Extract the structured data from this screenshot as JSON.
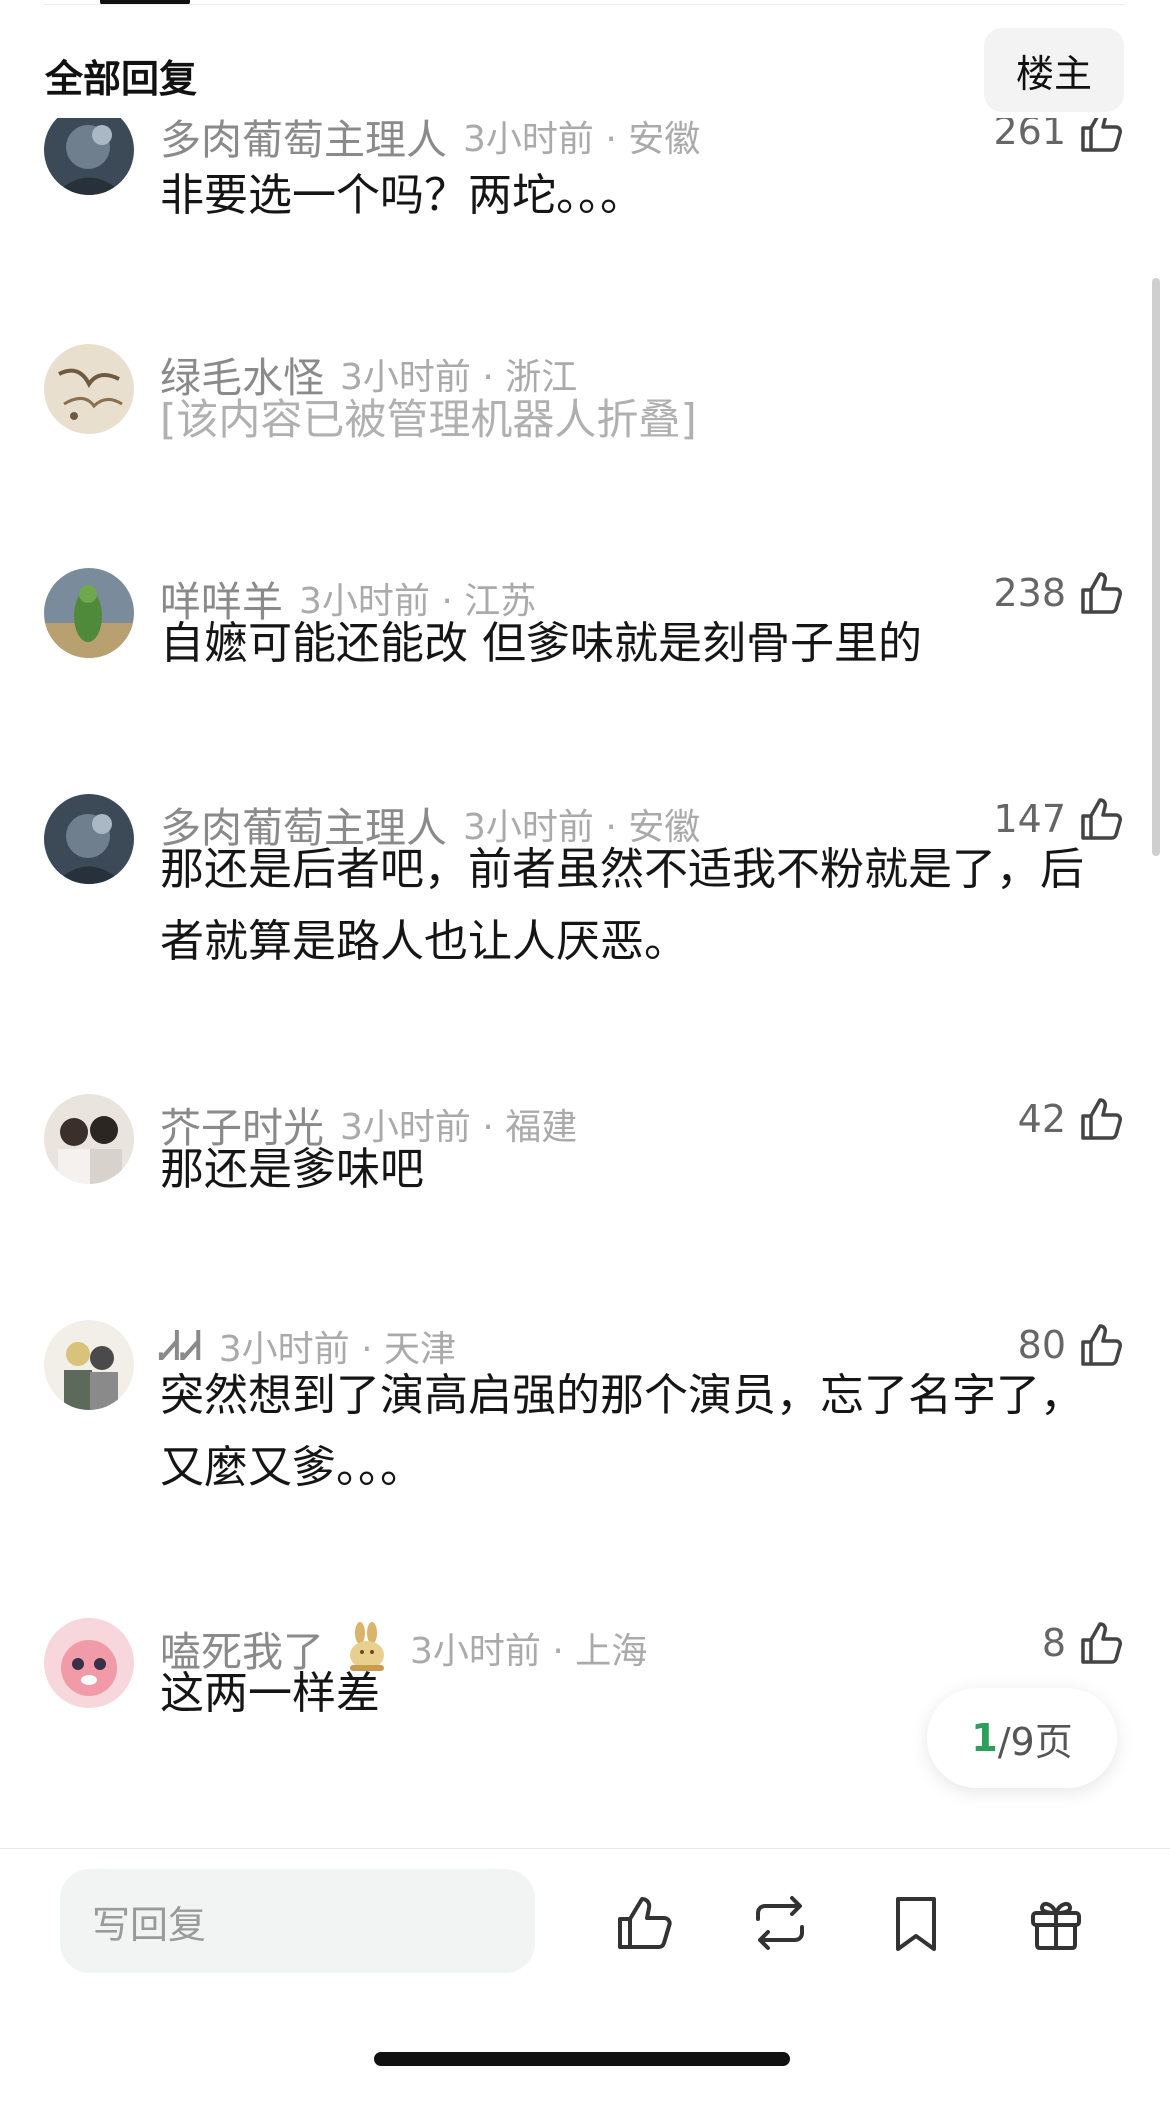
{
  "header": {
    "title": "全部回复",
    "owner_button": "楼主"
  },
  "comments": [
    {
      "username": "多肉葡萄主理人",
      "time": "3小时前",
      "location": "安徽",
      "likes": "261",
      "content": "非要选一个吗？两坨。。。"
    },
    {
      "username": "绿毛水怪",
      "time": "3小时前",
      "location": "浙江",
      "likes": "",
      "content": "[该内容已被管理机器人折叠]"
    },
    {
      "username": "咩咩羊",
      "time": "3小时前",
      "location": "江苏",
      "likes": "238",
      "content": "自嬷可能还能改 但爹味就是刻骨子里的"
    },
    {
      "username": "多肉葡萄主理人",
      "time": "3小时前",
      "location": "安徽",
      "likes": "147",
      "content": "那还是后者吧，前者虽然不适我不粉就是了，后者就算是路人也让人厌恶。"
    },
    {
      "username": "芥子时光",
      "time": "3小时前",
      "location": "福建",
      "likes": "42",
      "content": "那还是爹味吧"
    },
    {
      "username": "ᏗᏗ",
      "time": "3小时前",
      "location": "天津",
      "likes": "80",
      "content": "突然想到了演高启强的那个演员，忘了名字了，又麼又爹。。。"
    },
    {
      "username": "嗑死我了",
      "time": "3小时前",
      "location": "上海",
      "likes": "8",
      "content": "这两一样差"
    }
  ],
  "meta_separator": "·",
  "pagination": {
    "current": "1",
    "total": "/9页"
  },
  "bottom_bar": {
    "reply_placeholder": "写回复"
  },
  "icons": {
    "like": "thumbs-up-icon",
    "repost": "repost-icon",
    "bookmark": "bookmark-icon",
    "gift": "gift-icon",
    "badge": "rabbit-badge-icon"
  },
  "colors": {
    "accent_green": "#2aa05a",
    "muted_text": "#8a8a8a",
    "meta_text": "#aaaaaa"
  }
}
